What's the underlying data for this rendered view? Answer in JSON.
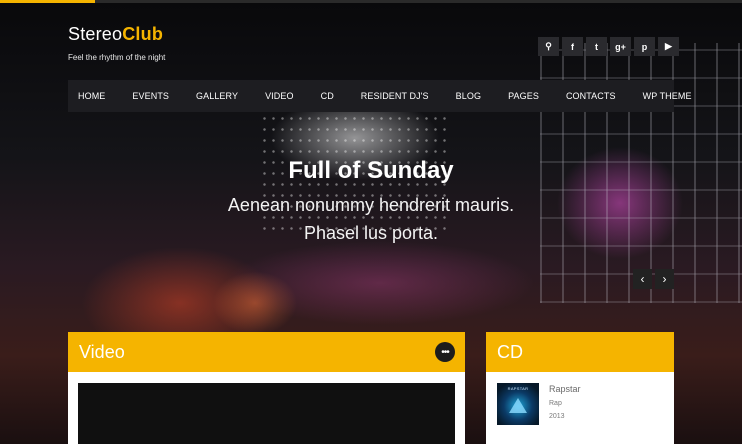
{
  "brand": {
    "name_regular": "Stereo",
    "name_bold": "Club",
    "tagline": "Feel the rhythm of the night"
  },
  "social": [
    {
      "icon": "search-icon",
      "glyph": "⚲"
    },
    {
      "icon": "facebook-icon",
      "glyph": "f"
    },
    {
      "icon": "twitter-icon",
      "glyph": "t"
    },
    {
      "icon": "google-plus-icon",
      "glyph": "g+"
    },
    {
      "icon": "pinterest-icon",
      "glyph": "p"
    },
    {
      "icon": "youtube-icon",
      "glyph": "▶"
    }
  ],
  "nav": [
    "HOME",
    "EVENTS",
    "GALLERY",
    "VIDEO",
    "CD",
    "RESIDENT DJ'S",
    "BLOG",
    "PAGES",
    "CONTACTS",
    "WP THEME"
  ],
  "hero": {
    "title": "Full of Sunday",
    "line1": "Aenean nonummy hendrerit mauris.",
    "line2": "Phasel lus porta."
  },
  "slider": {
    "prev_glyph": "‹",
    "next_glyph": "›"
  },
  "video_panel": {
    "title": "Video",
    "more_glyph": "•••"
  },
  "cd_panel": {
    "title": "CD",
    "cover_label": "RAPSTAR",
    "album": {
      "title": "Rapstar",
      "genre": "Rap",
      "year": "2013"
    }
  },
  "colors": {
    "accent": "#f5b400",
    "nav_bg": "#1d1d21",
    "icon_bg": "#2a2a2e"
  }
}
